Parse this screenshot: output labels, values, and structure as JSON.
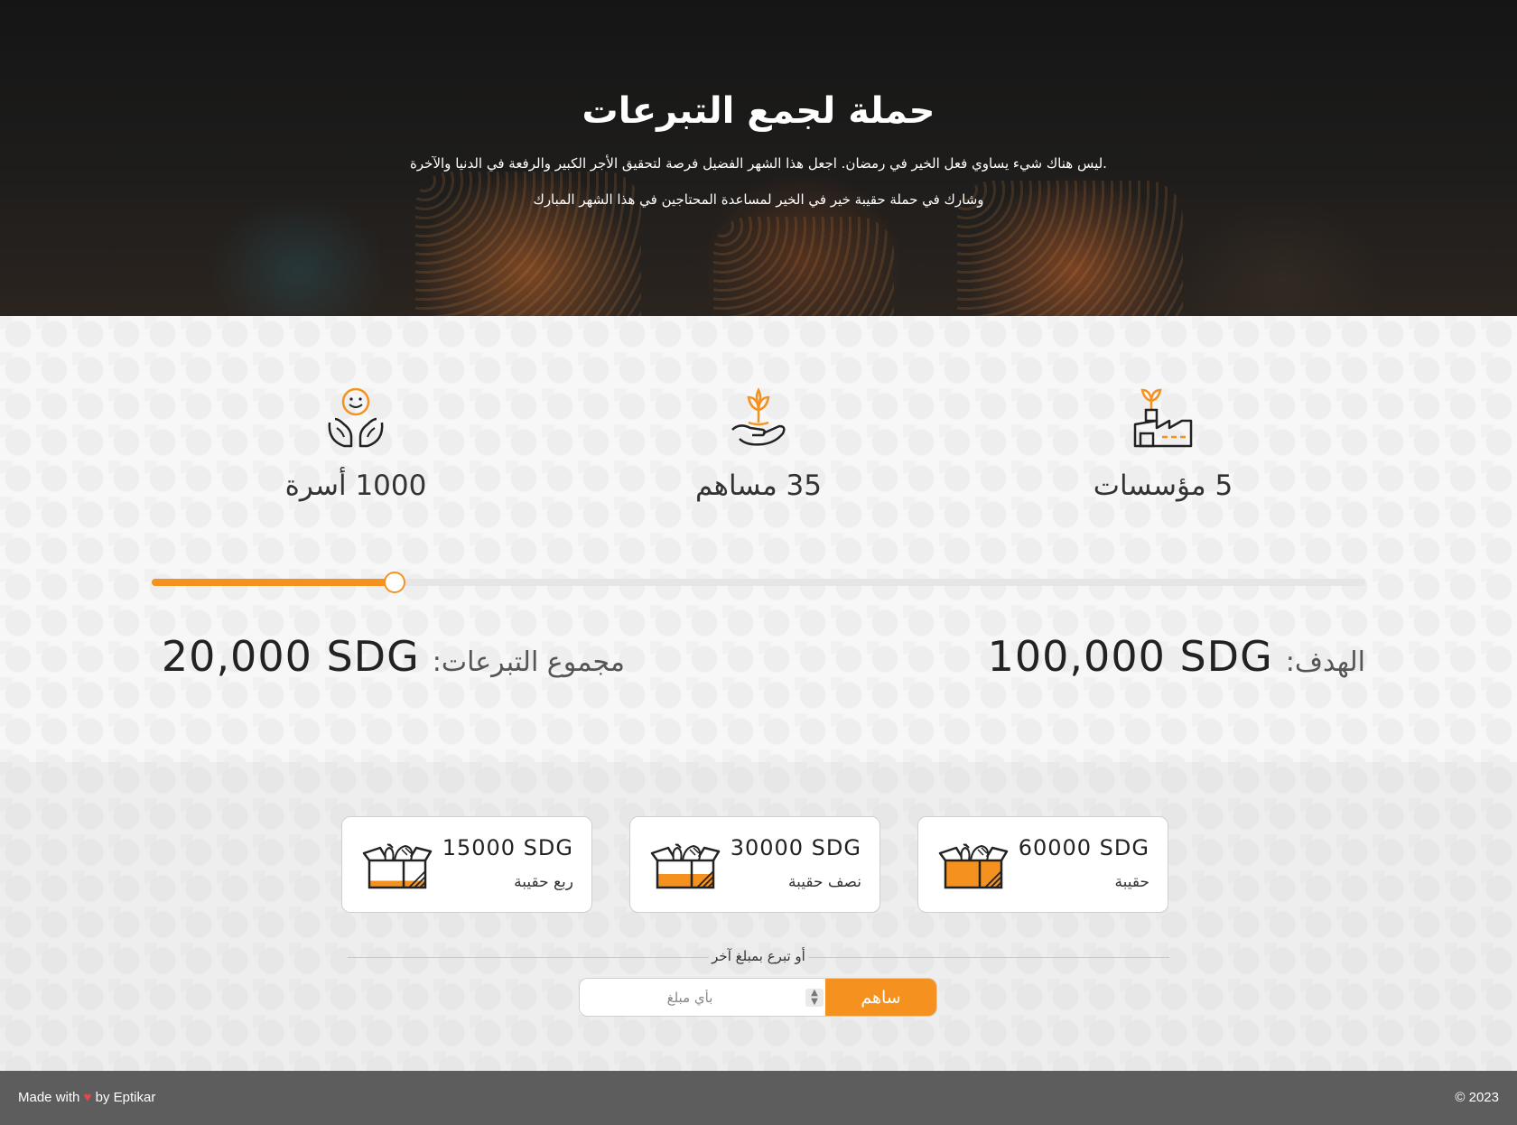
{
  "hero": {
    "title": "حملة لجمع التبرعات",
    "line1": "ليس هناك شيء يساوي فعل الخير في رمضان. اجعل هذا الشهر الفضيل فرصة لتحقيق الأجر الكبير والرفعة في الدنيا والآخرة.",
    "line2": "وشارك في حملة حقيبة خير في الخير لمساعدة المحتاجين في هذا الشهر المبارك"
  },
  "stats": [
    {
      "icon": "hands-smile-icon",
      "text": "1000 أسرة"
    },
    {
      "icon": "hand-plant-icon",
      "text": "35 مساهم"
    },
    {
      "icon": "factory-plant-icon",
      "text": "5 مؤسسات"
    }
  ],
  "progress": {
    "fraction": 0.2,
    "color": "#f5921f"
  },
  "goal": {
    "label": "الهدف:",
    "value": "100,000 SDG"
  },
  "total": {
    "label": "مجموع التبرعات:",
    "value": "20,000 SDG"
  },
  "packages": [
    {
      "price": "60000 SDG",
      "label": "حقيبة",
      "fill": 1.0
    },
    {
      "price": "30000 SDG",
      "label": "نصف حقيبة",
      "fill": 0.5
    },
    {
      "price": "15000 SDG",
      "label": "ربع حقيبة",
      "fill": 0.25
    }
  ],
  "other_amount": {
    "divider_text": "أو تبرع بمبلغ آخر",
    "placeholder": "بأي مبلغ",
    "button_label": "ساهم"
  },
  "footer": {
    "made_with": "Made with",
    "by": "by Eptikar",
    "copyright": "© 2023"
  },
  "colors": {
    "accent": "#f5921f",
    "footer": "#5d5d5d"
  }
}
